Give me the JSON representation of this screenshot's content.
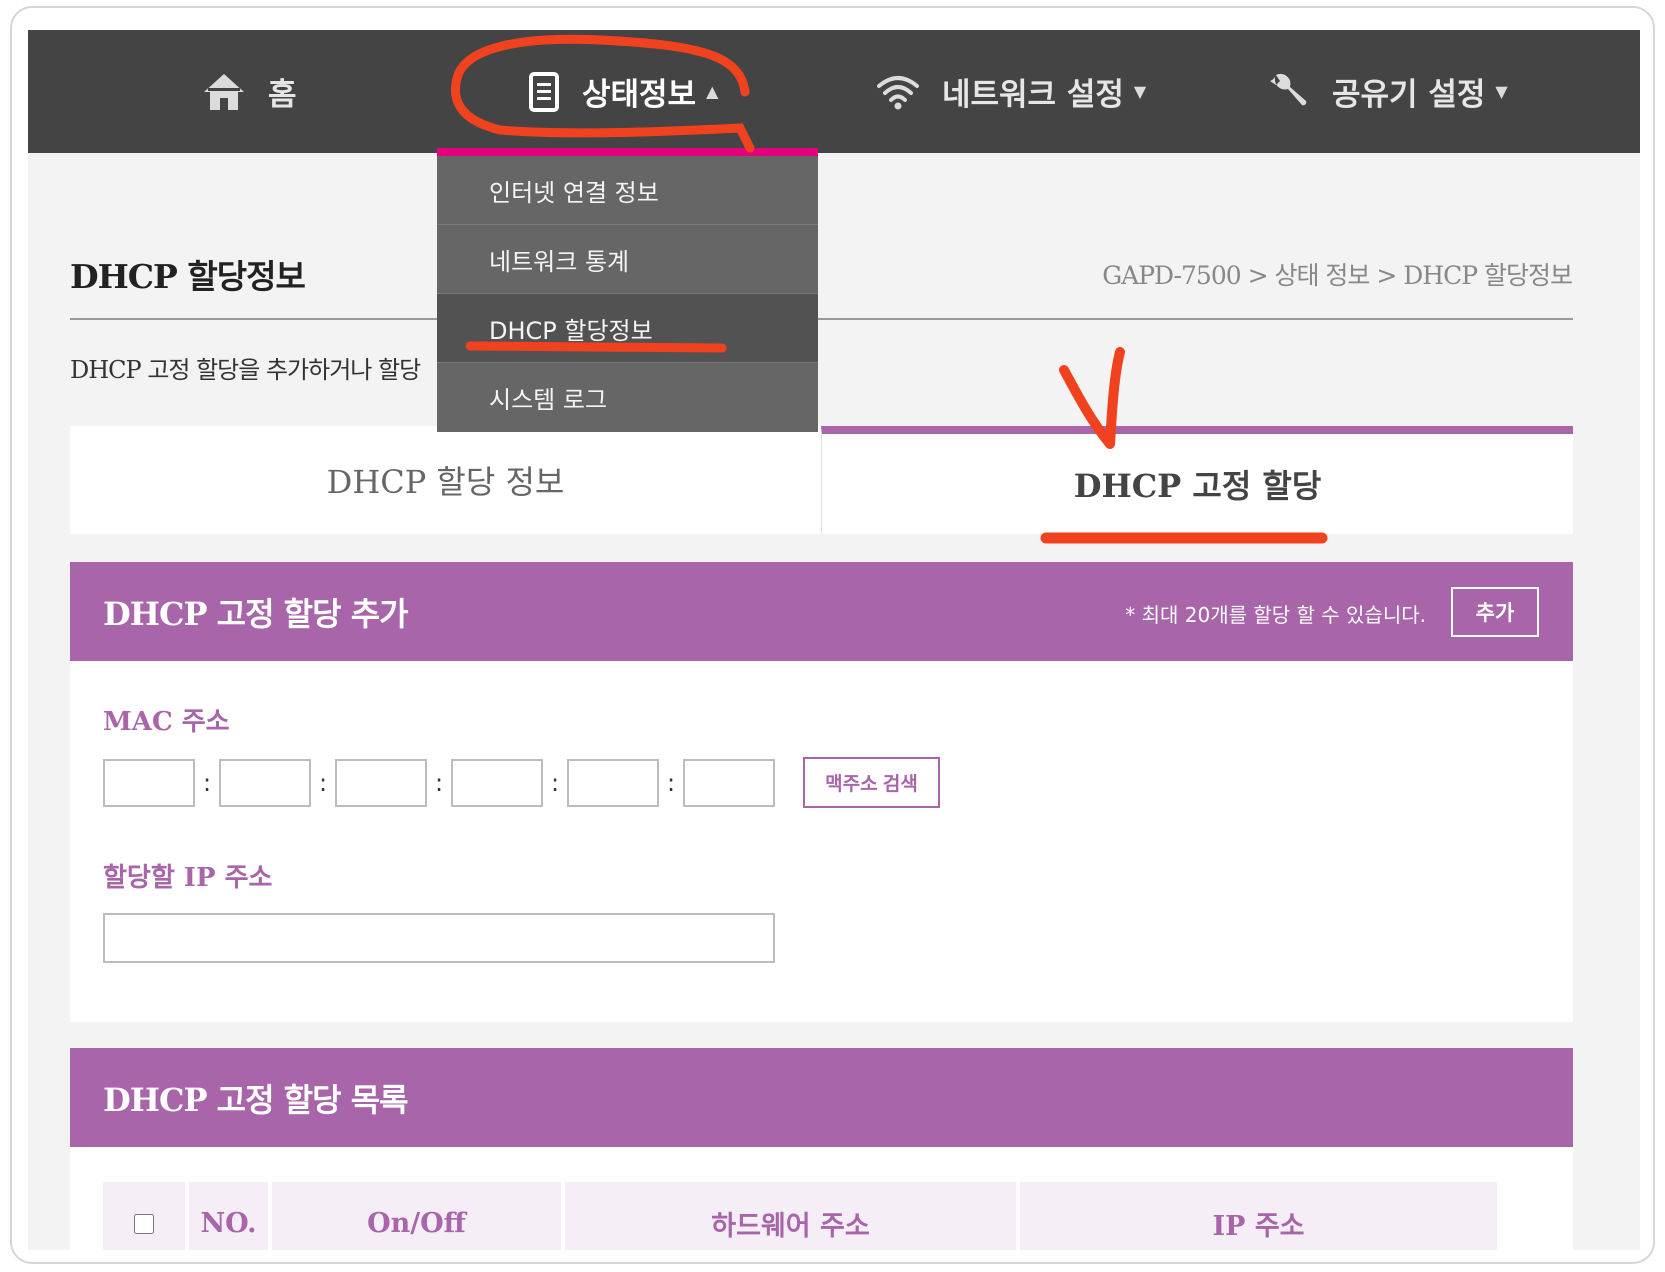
{
  "nav": {
    "home": "홈",
    "status": "상태정보",
    "network": "네트워크 설정",
    "router": "공유기 설정"
  },
  "dropdown": {
    "items": [
      "인터넷 연결 정보",
      "네트워크 통계",
      "DHCP 할당정보",
      "시스템 로그"
    ],
    "active_index": 2
  },
  "page": {
    "title": "DHCP 할당정보",
    "breadcrumb": "GAPD-7500 > 상태 정보 > DHCP 할당정보",
    "description": "DHCP 고정 할당을 추가하거나 할당"
  },
  "tabs": [
    "DHCP 할당 정보",
    "DHCP 고정 할당"
  ],
  "active_tab": 1,
  "add_panel": {
    "title": "DHCP 고정 할당 추가",
    "note": "* 최대 20개를 할당 할 수 있습니다.",
    "add_button": "추가",
    "mac_label": "MAC 주소",
    "mac_separator": ":",
    "search_button": "맥주소 검색",
    "ip_label": "할당할 IP 주소"
  },
  "list_panel": {
    "title": "DHCP 고정 할당 목록",
    "columns": [
      "NO.",
      "On/Off",
      "하드웨어 주소",
      "IP 주소"
    ]
  },
  "colors": {
    "accent": "#a865aa",
    "nav_bg": "#444444",
    "dropdown_bg": "#666666",
    "dropdown_accent": "#e5007e",
    "annotation": "#f0421e"
  }
}
